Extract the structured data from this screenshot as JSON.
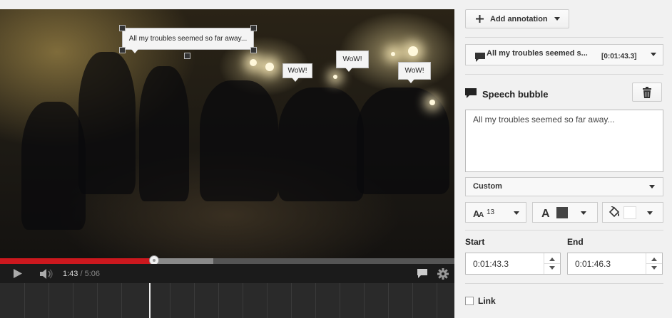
{
  "player": {
    "current_time": "1:43",
    "separator": " / ",
    "duration": "5:06",
    "progress_played_fraction": 0.341,
    "progress_loaded_fraction": 0.469
  },
  "annotations": {
    "selected_text": "All my troubles seemed so far away...",
    "wow_1": "WoW!",
    "wow_2": "WoW!",
    "wow_3": "WoW!"
  },
  "panel": {
    "add_annotation_label": "Add annotation",
    "annotation_select_text": "All my troubles seemed s...",
    "annotation_select_time": "[0:01:43.3]",
    "section_title": "Speech bubble",
    "annotation_body": "All my troubles seemed so far away...",
    "style_select": "Custom",
    "font_size": "13",
    "start_label": "Start",
    "end_label": "End",
    "start_value": "0:01:43.3",
    "end_value": "0:01:46.3",
    "link_label": "Link"
  },
  "colors": {
    "progress_played": "#cc181e",
    "text_color_swatch": "#444444",
    "background_color_swatch": "#ffffff"
  },
  "icons": [
    "play-icon",
    "volume-icon",
    "speech-bubble-icon",
    "gear-icon",
    "plus-icon",
    "trash-icon",
    "text-size-icon",
    "text-color-icon",
    "paint-bucket-icon"
  ]
}
